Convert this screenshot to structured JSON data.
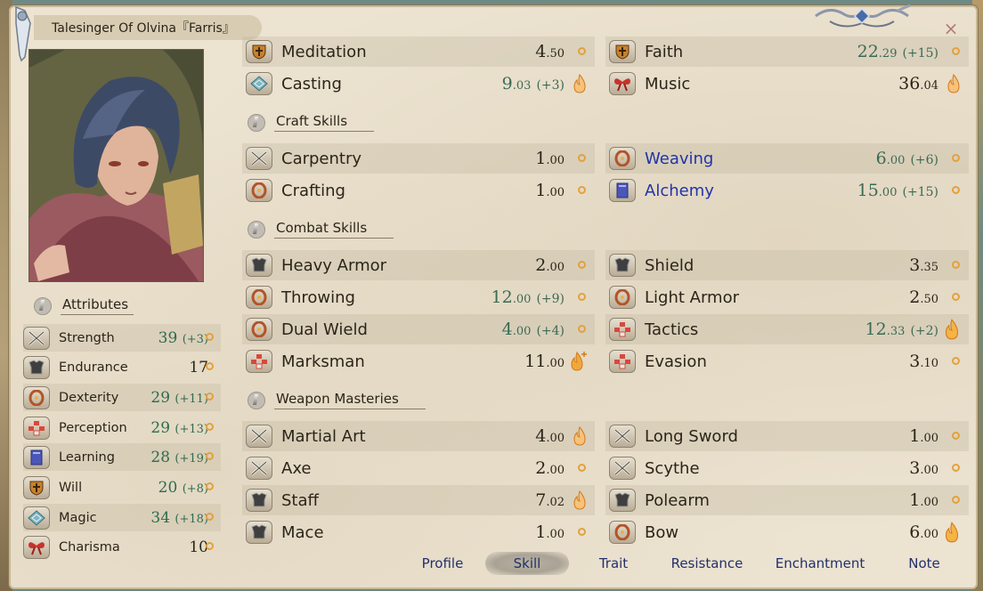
{
  "title": "Talesinger Of Olvina『Farris』",
  "close_label": "×",
  "sections": {
    "attributes": "Attributes",
    "craft": "Craft Skills",
    "combat": "Combat Skills",
    "weapon": "Weapon Masteries"
  },
  "attributes": [
    {
      "name": "Strength",
      "value": "39",
      "bonus": "(+3)",
      "icon": "crossed-swords-icon"
    },
    {
      "name": "Endurance",
      "value": "17",
      "bonus": "",
      "icon": "armor-icon"
    },
    {
      "name": "Dexterity",
      "value": "29",
      "bonus": "(+11)",
      "icon": "ring-icon"
    },
    {
      "name": "Perception",
      "value": "29",
      "bonus": "(+13)",
      "icon": "eye-grid-icon"
    },
    {
      "name": "Learning",
      "value": "28",
      "bonus": "(+19)",
      "icon": "book-icon"
    },
    {
      "name": "Will",
      "value": "20",
      "bonus": "(+8)",
      "icon": "shield-crest-icon"
    },
    {
      "name": "Magic",
      "value": "34",
      "bonus": "(+18)",
      "icon": "magic-rune-icon"
    },
    {
      "name": "Charisma",
      "value": "10",
      "bonus": "",
      "icon": "ribbon-icon"
    }
  ],
  "skills": {
    "top_left": [
      {
        "name": "Meditation",
        "int": "4",
        "dec": ".50",
        "bonus": "",
        "icon": "shield-crest-icon",
        "mark": "dot"
      },
      {
        "name": "Casting",
        "int": "9",
        "dec": ".03",
        "bonus": "(+3)",
        "icon": "magic-rune-icon",
        "mark": "flame"
      }
    ],
    "top_right": [
      {
        "name": "Faith",
        "int": "22",
        "dec": ".29",
        "bonus": "(+15)",
        "icon": "shield-crest-icon",
        "mark": "dot"
      },
      {
        "name": "Music",
        "int": "36",
        "dec": ".04",
        "bonus": "",
        "icon": "ribbon-icon",
        "mark": "flame"
      }
    ],
    "craft_left": [
      {
        "name": "Carpentry",
        "int": "1",
        "dec": ".00",
        "bonus": "",
        "icon": "crossed-swords-icon",
        "mark": "dot"
      },
      {
        "name": "Crafting",
        "int": "1",
        "dec": ".00",
        "bonus": "",
        "icon": "ring-icon",
        "mark": "dot"
      }
    ],
    "craft_right": [
      {
        "name": "Weaving",
        "int": "6",
        "dec": ".00",
        "bonus": "(+6)",
        "icon": "ring-icon",
        "mark": "dot",
        "highlight": true
      },
      {
        "name": "Alchemy",
        "int": "15",
        "dec": ".00",
        "bonus": "(+15)",
        "icon": "book-icon",
        "mark": "dot",
        "highlight": true
      }
    ],
    "combat_left": [
      {
        "name": "Heavy Armor",
        "int": "2",
        "dec": ".00",
        "bonus": "",
        "icon": "armor-icon",
        "mark": "dot"
      },
      {
        "name": "Throwing",
        "int": "12",
        "dec": ".00",
        "bonus": "(+9)",
        "icon": "ring-icon",
        "mark": "dot"
      },
      {
        "name": "Dual Wield",
        "int": "4",
        "dec": ".00",
        "bonus": "(+4)",
        "icon": "ring-icon",
        "mark": "dot"
      },
      {
        "name": "Marksman",
        "int": "11",
        "dec": ".00",
        "bonus": "",
        "icon": "eye-grid-icon",
        "mark": "flame-plus"
      }
    ],
    "combat_right": [
      {
        "name": "Shield",
        "int": "3",
        "dec": ".35",
        "bonus": "",
        "icon": "armor-icon",
        "mark": "dot"
      },
      {
        "name": "Light Armor",
        "int": "2",
        "dec": ".50",
        "bonus": "",
        "icon": "ring-icon",
        "mark": "dot"
      },
      {
        "name": "Tactics",
        "int": "12",
        "dec": ".33",
        "bonus": "(+2)",
        "icon": "eye-grid-icon",
        "mark": "flame-big"
      },
      {
        "name": "Evasion",
        "int": "3",
        "dec": ".10",
        "bonus": "",
        "icon": "eye-grid-icon",
        "mark": "dot"
      }
    ],
    "weapon_left": [
      {
        "name": "Martial Art",
        "int": "4",
        "dec": ".00",
        "bonus": "",
        "icon": "crossed-swords-icon",
        "mark": "flame"
      },
      {
        "name": "Axe",
        "int": "2",
        "dec": ".00",
        "bonus": "",
        "icon": "crossed-swords-icon",
        "mark": "dot"
      },
      {
        "name": "Staff",
        "int": "7",
        "dec": ".02",
        "bonus": "",
        "icon": "armor-icon",
        "mark": "flame"
      },
      {
        "name": "Mace",
        "int": "1",
        "dec": ".00",
        "bonus": "",
        "icon": "armor-icon",
        "mark": "dot"
      }
    ],
    "weapon_right": [
      {
        "name": "Long Sword",
        "int": "1",
        "dec": ".00",
        "bonus": "",
        "icon": "crossed-swords-icon",
        "mark": "dot"
      },
      {
        "name": "Scythe",
        "int": "3",
        "dec": ".00",
        "bonus": "",
        "icon": "crossed-swords-icon",
        "mark": "dot"
      },
      {
        "name": "Polearm",
        "int": "1",
        "dec": ".00",
        "bonus": "",
        "icon": "armor-icon",
        "mark": "dot"
      },
      {
        "name": "Bow",
        "int": "6",
        "dec": ".00",
        "bonus": "",
        "icon": "ring-icon",
        "mark": "flame-big"
      }
    ]
  },
  "tabs": [
    {
      "label": "Profile",
      "active": false
    },
    {
      "label": "Skill",
      "active": true
    },
    {
      "label": "Trait",
      "active": false
    },
    {
      "label": "Resistance",
      "active": false
    },
    {
      "label": "Enchantment",
      "active": false
    },
    {
      "label": "Note",
      "active": false
    }
  ],
  "colors": {
    "panel_bg": "#ece3d1",
    "bonus_green": "#3b6a55",
    "highlight_blue": "#2233aa",
    "tab_text": "#23306b",
    "potential_orange": "#e3a13c"
  }
}
